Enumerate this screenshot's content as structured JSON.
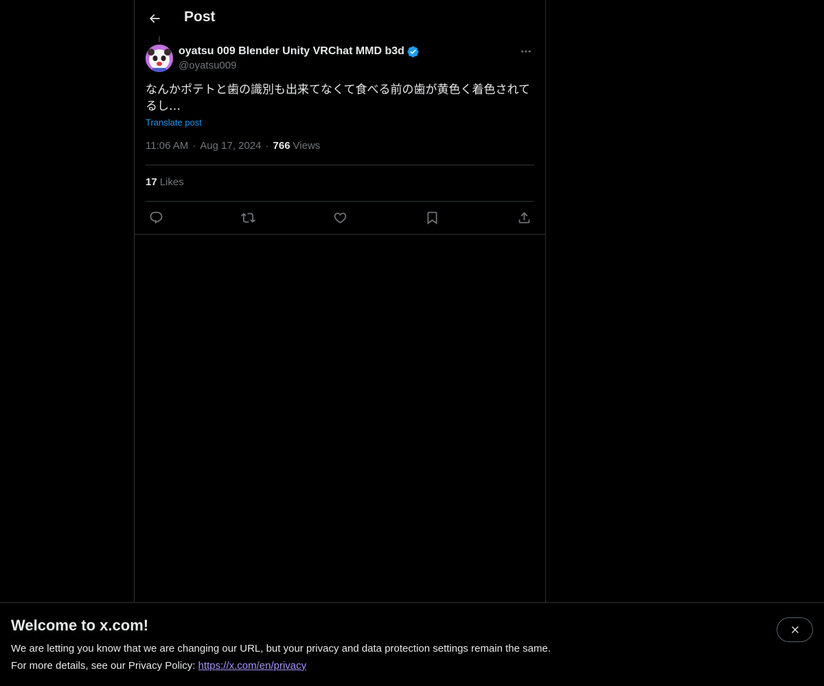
{
  "header": {
    "title": "Post"
  },
  "post": {
    "author_name": "oyatsu 009 Blender Unity VRChat MMD b3d",
    "author_handle": "@oyatsu009",
    "text": "なんかポテトと歯の識別も出来てなくて食べる前の歯が黄色く着色されてるし…",
    "translate_label": "Translate post",
    "time": "11:06 AM",
    "date": "Aug 17, 2024",
    "views_count": "766",
    "views_label": "Views",
    "likes_count": "17",
    "likes_label": "Likes"
  },
  "actions": {
    "icons": [
      "reply-icon",
      "repost-icon",
      "like-icon",
      "bookmark-icon",
      "share-icon"
    ]
  },
  "banner": {
    "title": "Welcome to x.com!",
    "line1": "We are letting you know that we are changing our URL, but your privacy and data protection settings remain the same.",
    "line2_prefix": "For more details, see our Privacy Policy: ",
    "privacy_link": "https://x.com/en/privacy"
  },
  "colors": {
    "background": "#000000",
    "text": "#e7e9ea",
    "muted": "#71767b",
    "accent": "#1d9bf0",
    "border": "#2f3336",
    "link_visited": "#a594f9"
  }
}
